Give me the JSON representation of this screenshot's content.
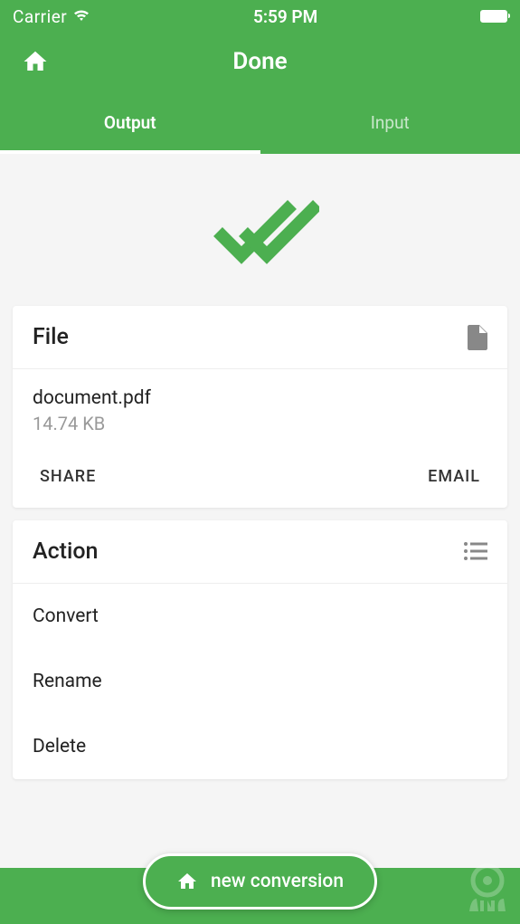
{
  "status_bar": {
    "carrier": "Carrier",
    "time": "5:59 PM"
  },
  "nav": {
    "title": "Done"
  },
  "tabs": {
    "output": "Output",
    "input": "Input"
  },
  "file_card": {
    "title": "File",
    "name": "document.pdf",
    "size": "14.74 KB",
    "share": "SHARE",
    "email": "EMAIL"
  },
  "action_card": {
    "title": "Action",
    "items": {
      "convert": "Convert",
      "rename": "Rename",
      "delete": "Delete"
    }
  },
  "bottom_button": {
    "label": "new conversion"
  }
}
